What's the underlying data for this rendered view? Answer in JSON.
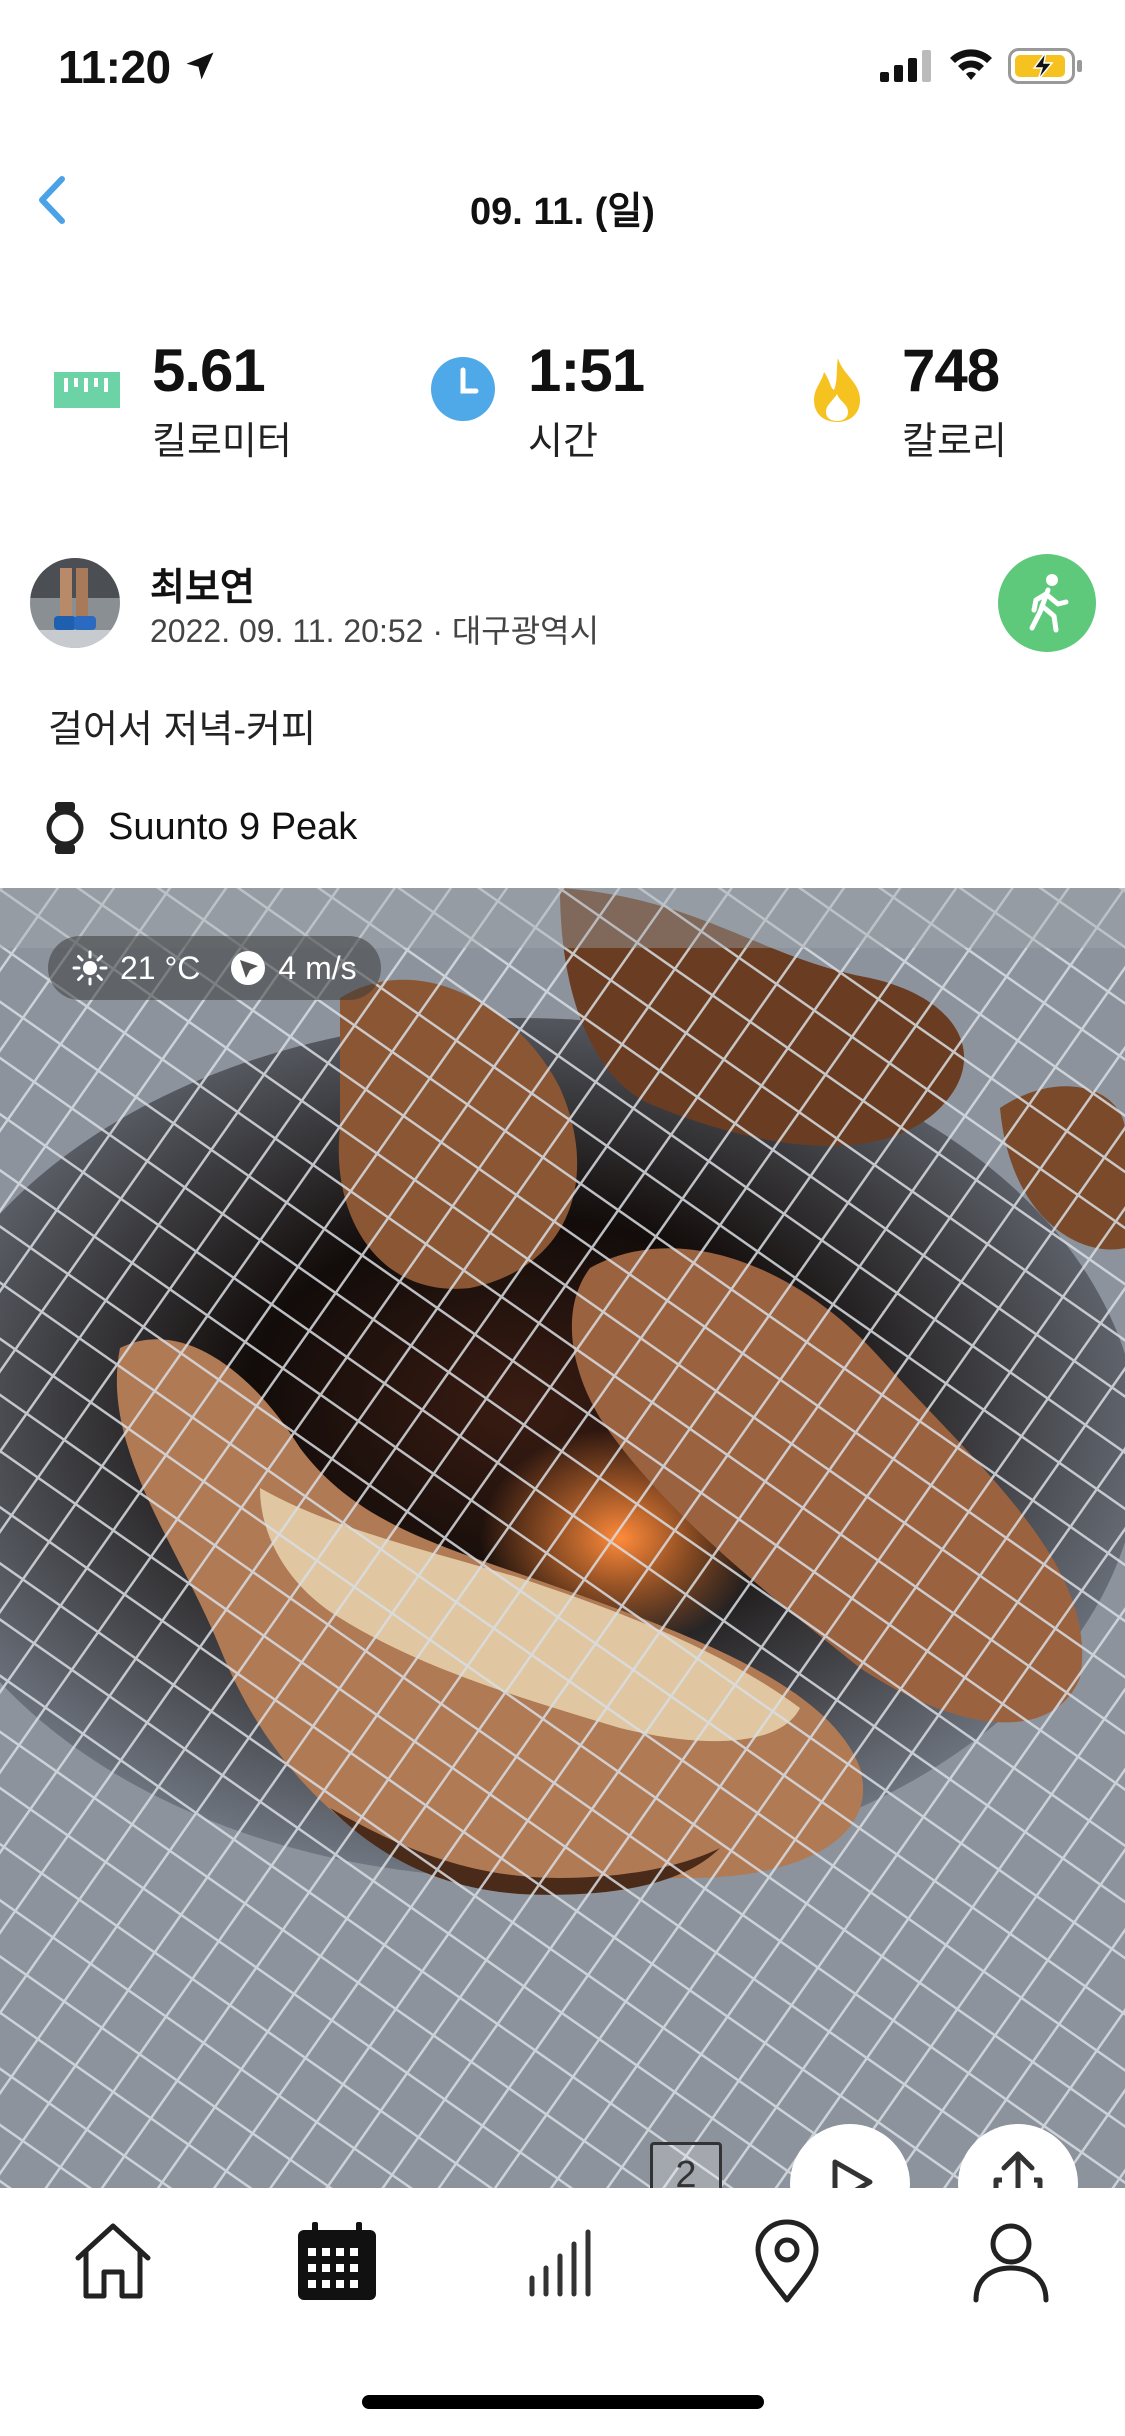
{
  "status": {
    "time": "11:20"
  },
  "header": {
    "date": "09. 11. (일)"
  },
  "stats": [
    {
      "value": "5.61",
      "label": "킬로미터",
      "icon": "ruler-icon",
      "color": "#6cd3a6"
    },
    {
      "value": "1:51",
      "label": "시간",
      "icon": "clock-icon",
      "color": "#4fa9e8"
    },
    {
      "value": "748",
      "label": "칼로리",
      "icon": "flame-icon",
      "color": "#f6c21f"
    }
  ],
  "post": {
    "author": "최보연",
    "meta": "2022. 09. 11. 20:52 · 대구광역시",
    "description": "걸어서 저녁-커피",
    "device": "Suunto 9 Peak",
    "activity_icon": "walking-icon",
    "activity_color": "#5ec97a"
  },
  "photo": {
    "temperature": "21 °C",
    "wind": "4 m/s",
    "count": "2"
  },
  "tabs": [
    {
      "name": "home",
      "icon": "home-icon"
    },
    {
      "name": "calendar",
      "icon": "calendar-icon",
      "active": true
    },
    {
      "name": "stats",
      "icon": "bar-chart-icon"
    },
    {
      "name": "map",
      "icon": "map-pin-icon"
    },
    {
      "name": "profile",
      "icon": "person-icon"
    }
  ]
}
